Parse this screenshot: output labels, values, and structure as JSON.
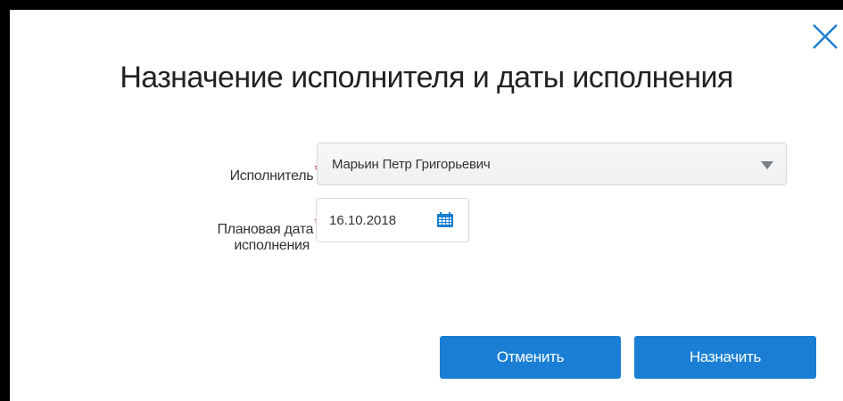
{
  "dialog": {
    "title": "Назначение исполнителя и даты исполнения",
    "close_icon": "close-icon"
  },
  "form": {
    "executor": {
      "label": "Исполнитель",
      "required_mark": "*",
      "value": "Марьин Петр Григорьевич",
      "icon": "chevron-down-icon"
    },
    "planned_date": {
      "label_line1": "Плановая дата",
      "label_line2": "исполнения",
      "required_mark": "*",
      "value": "16.10.2018",
      "icon": "calendar-icon"
    }
  },
  "buttons": {
    "cancel_label": "Отменить",
    "assign_label": "Назначить"
  },
  "colors": {
    "accent": "#1a7fd4",
    "required": "#c0392b",
    "calendar_icon": "#1a7fd4"
  }
}
